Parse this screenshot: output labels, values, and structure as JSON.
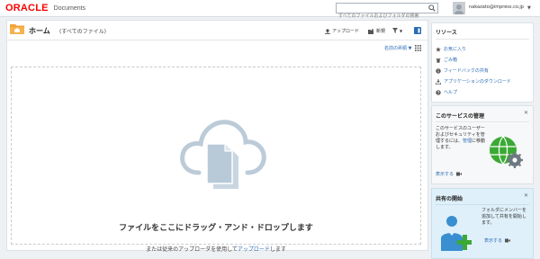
{
  "header": {
    "logo_text": "ORACLE",
    "product_name": "Documents",
    "search_placeholder": "すべてのファイルおよびフォルダの検索",
    "user_name": "nakazato@impress.co.jp",
    "user_caret": "▼"
  },
  "main": {
    "title": "ホーム",
    "subtitle": "(すべてのファイル)",
    "toolbar": {
      "upload_label": "アップロード",
      "new_label": "新規",
      "filter_caret": "▼"
    },
    "sort_label": "名前の昇順",
    "sort_caret": "▼",
    "dropzone": {
      "main_text": "ファイルをここにドラッグ・アンド・ドロップします",
      "sub_text_prefix": "または従来のアップローダを使用して",
      "sub_link": "アップロード",
      "sub_text_suffix": "します"
    }
  },
  "resources": {
    "title": "リソース",
    "items": [
      {
        "label": "お気に入り",
        "icon": "star-icon"
      },
      {
        "label": "ごみ箱",
        "icon": "trash-icon"
      },
      {
        "label": "フィードバックの共有",
        "icon": "info-icon"
      },
      {
        "label": "アプリケーションのダウンロード",
        "icon": "download-icon"
      },
      {
        "label": "ヘルプ",
        "icon": "help-icon"
      }
    ]
  },
  "manage_panel": {
    "title": "このサービスの管理",
    "close": "✕",
    "text_1": "このサービスのユーザーおよびセキュリティを管理するには、",
    "text_link": "管理",
    "text_2": "に移動します。",
    "show_label": "表示する"
  },
  "share_panel": {
    "title": "共有の開始",
    "close": "✕",
    "text": "フォルダにメンバーを追加して共有を開始します。",
    "show_label": "表示する"
  },
  "colors": {
    "accent": "#2a6cb4",
    "brand_red": "#f80000",
    "folder": "#f0a23a",
    "green": "#3ba935"
  }
}
